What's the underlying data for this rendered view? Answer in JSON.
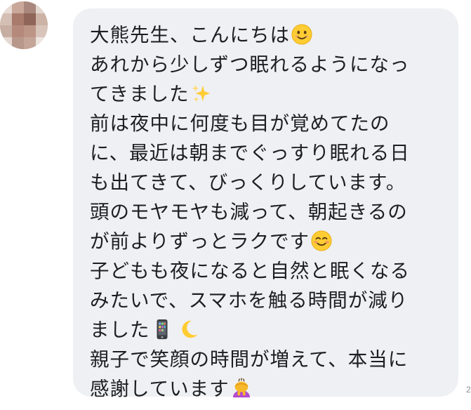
{
  "message": {
    "lines": [
      "大熊先生、こんにちは",
      "あれから少しずつ眠れるようになっ",
      "てきました",
      "前は夜中に何度も目が覚めてたの",
      "に、最近は朝までぐっすり眠れる日",
      "も出てきて、びっくりしています。",
      "頭のモヤモヤも減って、朝起きるの",
      "が前よりずっとラクです",
      "子どもも夜になると自然と眠くなる",
      "みたいで、スマホを触る時間が減り",
      "ました",
      "親子で笑顔の時間が増えて、本当に",
      "感謝しています"
    ],
    "emojis": {
      "line0": "smiling-face-emoji",
      "line2": "sparkles-emoji",
      "line7": "relieved-smile-emoji",
      "line10_a": "mobile-phone-emoji",
      "line10_b": "crescent-moon-emoji",
      "line12": "bowing-person-emoji"
    }
  },
  "timestamp": "2",
  "colors": {
    "bubble": "#eff0f3",
    "text": "#1c1e21",
    "emoji_yellow": "#ffcc33",
    "timestamp": "#8a8d91"
  }
}
